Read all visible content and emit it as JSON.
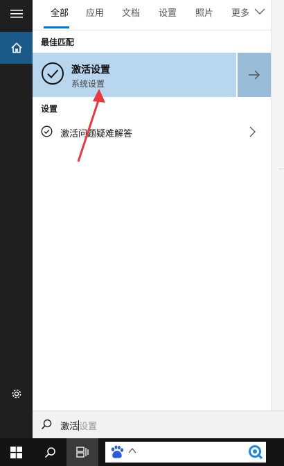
{
  "tabs": [
    {
      "label": "全部",
      "active": true
    },
    {
      "label": "应用",
      "active": false
    },
    {
      "label": "文档",
      "active": false
    },
    {
      "label": "设置",
      "active": false
    },
    {
      "label": "照片",
      "active": false
    },
    {
      "label": "更多",
      "active": false
    }
  ],
  "best_match": {
    "heading": "最佳匹配",
    "title": "激活设置",
    "subtitle": "系统设置"
  },
  "settings_section": {
    "heading": "设置",
    "items": [
      {
        "label": "激活问题疑难解答"
      }
    ]
  },
  "search": {
    "typed": "激活",
    "hint": "设置"
  },
  "icons": {
    "rail": [
      "hamburger-icon",
      "home-icon",
      "gear-icon"
    ],
    "taskbar": [
      "windows-start-icon",
      "search-icon",
      "task-view-icon",
      "baidu-paw-icon",
      "chevron-up-icon",
      "q-app-icon"
    ]
  },
  "colors": {
    "accent": "#0078d7",
    "best_match_bg": "#b9d6ef",
    "rail_home_active": "#1b5a88",
    "annotation_arrow": "#e8383d"
  }
}
